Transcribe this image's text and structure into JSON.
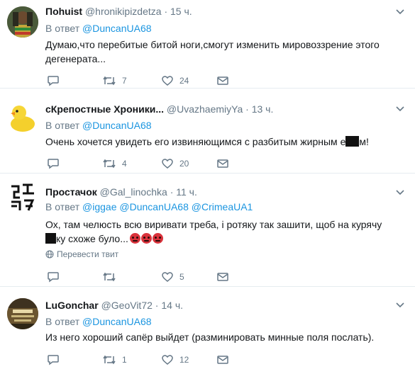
{
  "tweets": [
    {
      "name": "Пohuist",
      "handle": "@hronikipizdetza",
      "dot": "·",
      "time": "15 ч.",
      "reply_prefix": "В ответ",
      "mentions": [
        "@DuncanUA68"
      ],
      "text_line1": "Думаю,что перебитые битой ноги,смогут изменить мировоззрение этого",
      "text_line2": "дегенерата...",
      "retweets": "7",
      "likes": "24"
    },
    {
      "name": "сКрепостные Хроники...",
      "handle": "@UvazhaemiyYa",
      "dot": "·",
      "time": "13 ч.",
      "reply_prefix": "В ответ",
      "mentions": [
        "@DuncanUA68"
      ],
      "text_before": "Очень хочется увидеть его извиняющимся с разбитым жирным е",
      "text_after": "м!",
      "retweets": "4",
      "likes": "20"
    },
    {
      "name": "Простачок",
      "handle": "@Gal_linochka",
      "dot": "·",
      "time": "11 ч.",
      "reply_prefix": "В ответ",
      "mentions": [
        "@iggae",
        "@DuncanUA68",
        "@CrimeaUA1"
      ],
      "text_line1": "Ох, там челюсть всю виривати треба, і ротяку так зашити, щоб на курячу",
      "text_line2_before": "",
      "text_line2_after": "ку схоже було...",
      "translate_label": "Перевести твит",
      "retweets": "",
      "likes": "5"
    },
    {
      "name": "LuGonchar",
      "handle": "@GeoVit72",
      "dot": "·",
      "time": "14 ч.",
      "reply_prefix": "В ответ",
      "mentions": [
        "@DuncanUA68"
      ],
      "text_line1": "Из него хороший сапёр выйдет (разминировать минные поля послать).",
      "retweets": "1",
      "likes": "12"
    }
  ],
  "colors": {
    "link": "#1b95e0",
    "secondary_text": "#657786",
    "divider": "#e6ecf0",
    "censor": "#111111"
  },
  "icons": [
    "reply-icon",
    "retweet-icon",
    "like-icon",
    "message-icon",
    "caret-down-icon",
    "globe-icon",
    "angry-face-emoji"
  ]
}
